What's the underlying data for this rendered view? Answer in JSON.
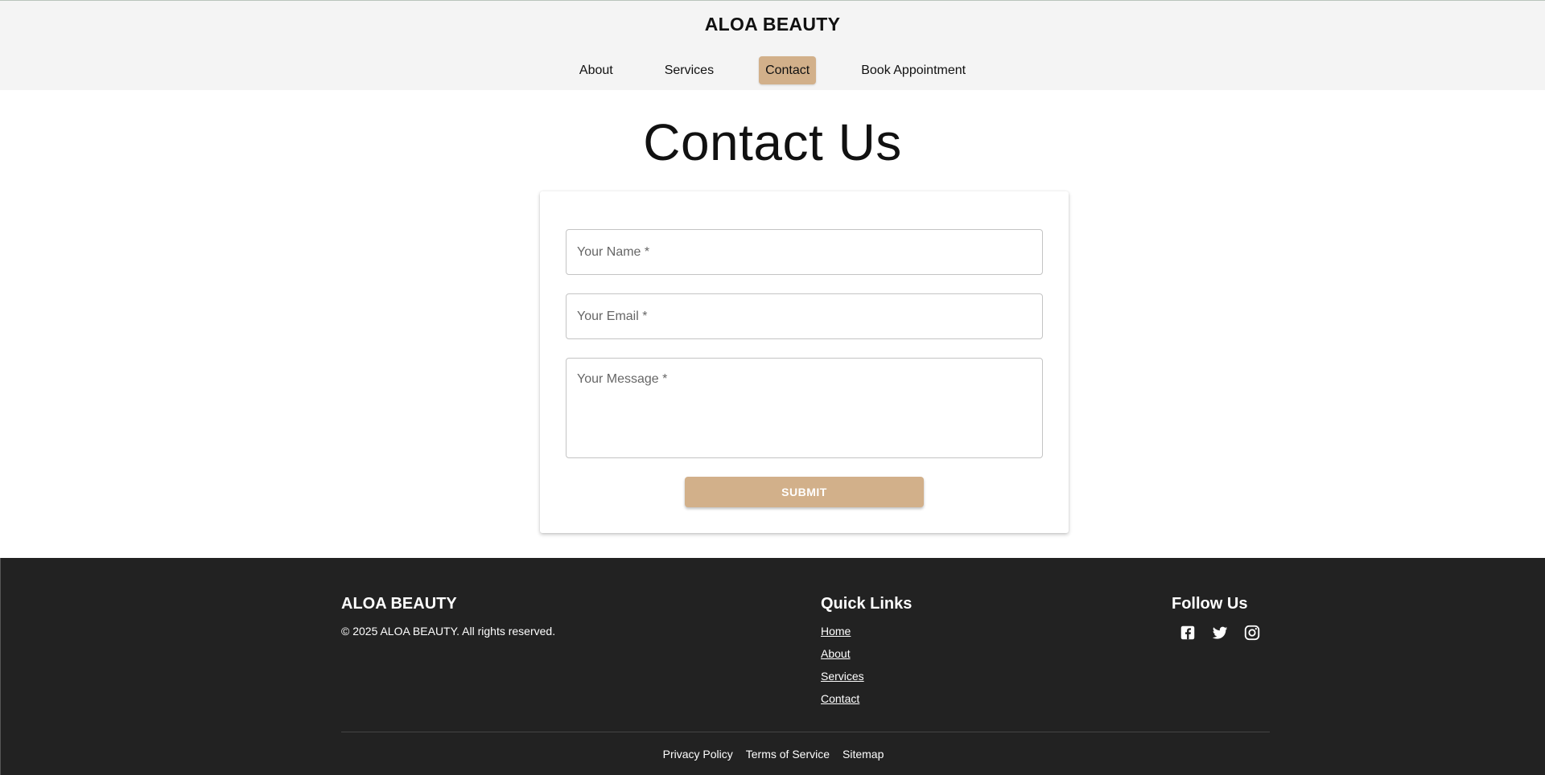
{
  "header": {
    "brand": "ALOA BEAUTY",
    "nav": [
      {
        "label": "About"
      },
      {
        "label": "Services"
      },
      {
        "label": "Contact",
        "active": true
      },
      {
        "label": "Book Appointment"
      }
    ],
    "active_color": "#d2b08a"
  },
  "main": {
    "title": "Contact Us",
    "form": {
      "name_placeholder": "Your Name *",
      "email_placeholder": "Your Email *",
      "message_placeholder": "Your Message *",
      "submit_label": "SUBMIT"
    }
  },
  "footer": {
    "brand": "ALOA BEAUTY",
    "copyright": "© 2025 ALOA BEAUTY. All rights reserved.",
    "quick_links_title": "Quick Links",
    "quick_links": [
      "Home",
      "About",
      "Services",
      "Contact"
    ],
    "follow_title": "Follow Us",
    "social_icons": [
      "facebook-icon",
      "twitter-icon",
      "instagram-icon"
    ],
    "legal_links": [
      "Privacy Policy",
      "Terms of Service",
      "Sitemap"
    ],
    "background": "#222222"
  }
}
